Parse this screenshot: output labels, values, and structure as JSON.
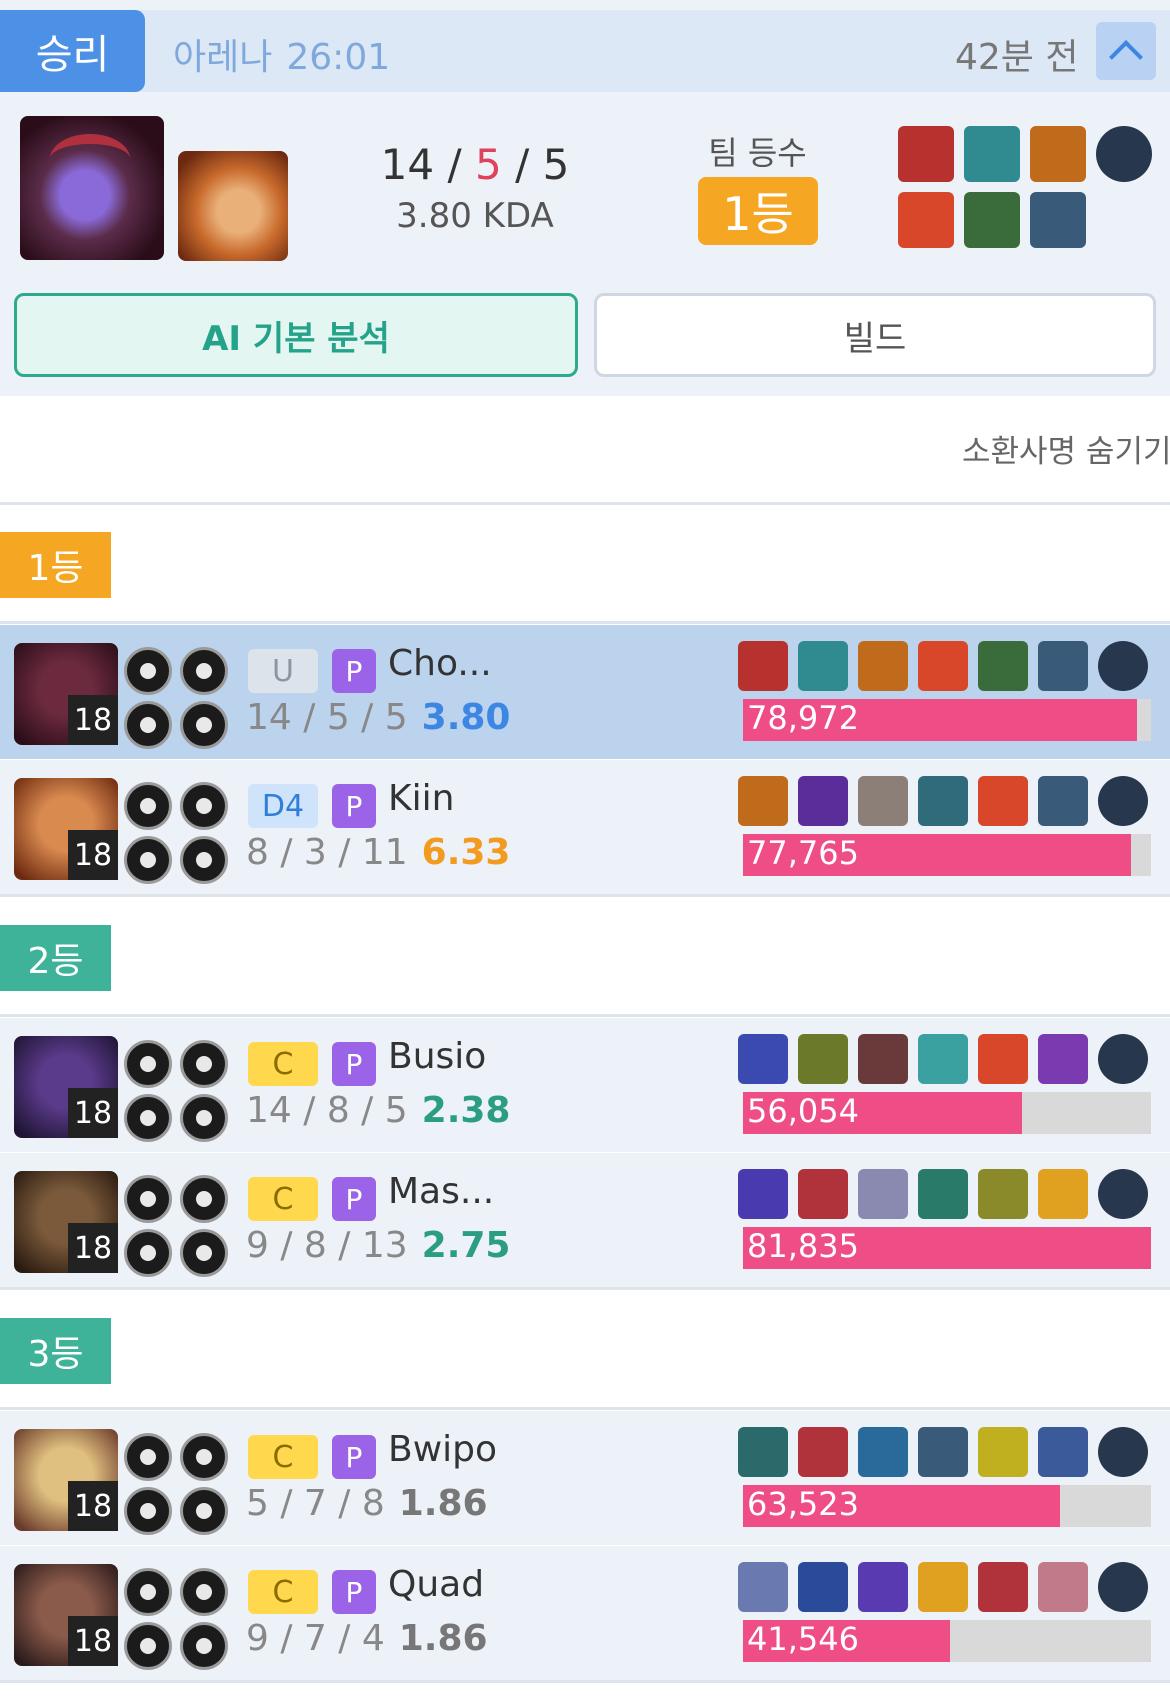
{
  "header": {
    "result": "승리",
    "mode": "아레나",
    "duration": "26:01",
    "time_ago": "42분 전"
  },
  "summary": {
    "kills": "14",
    "deaths": "5",
    "assists": "5",
    "kda_ratio": "3.80 KDA",
    "team_rank_label": "팀 등수",
    "team_rank": "1등"
  },
  "tabs": {
    "ai": "AI 기본 분석",
    "build": "빌드"
  },
  "hide_names_label": "소환사명 숨기기",
  "colors": {
    "win_blue": "#4c91e6",
    "rank_orange": "#f5a623",
    "rank_teal": "#3fb39a",
    "damage_pink": "#ee4d86",
    "ratio_blue": "#3d86e4",
    "ratio_orange": "#f29b20",
    "ratio_teal": "#2a9d82",
    "ratio_gray": "#777777"
  },
  "groups": [
    {
      "label": "1등",
      "color": "#f5a623",
      "players": [
        {
          "name": "Cho...",
          "tier": "U",
          "tier_bg": "#dde3ea",
          "tier_color": "#8c96a3",
          "badge": "P",
          "level": "18",
          "kills": "14",
          "deaths": "5",
          "assists": "5",
          "ratio": "3.80",
          "ratio_color": "#3d86e4",
          "damage": "78,972",
          "damage_fraction": 0.965,
          "me": true,
          "portrait": [
            "#6b2a3e",
            "#2a0d18"
          ],
          "items": [
            "#b7322f",
            "#2f8b8f",
            "#c06a1b",
            "#d9472b",
            "#3a6b3a",
            "#3a5a7a",
            "#26374e"
          ]
        },
        {
          "name": "Kiin",
          "tier": "D4",
          "tier_bg": "#cfe3fb",
          "tier_color": "#2f7fd8",
          "badge": "P",
          "level": "18",
          "kills": "8",
          "deaths": "3",
          "assists": "11",
          "ratio": "6.33",
          "ratio_color": "#f29b20",
          "damage": "77,765",
          "damage_fraction": 0.95,
          "me": false,
          "portrait": [
            "#d98a4f",
            "#6d2a10"
          ],
          "items": [
            "#c06a1b",
            "#5a2d9a",
            "#8b7f78",
            "#2f6b7a",
            "#d9472b",
            "#3a5a7a",
            "#26374e"
          ]
        }
      ]
    },
    {
      "label": "2등",
      "color": "#3fb39a",
      "players": [
        {
          "name": "Busio",
          "tier": "C",
          "tier_bg": "#ffd84d",
          "tier_color": "#8a6d00",
          "badge": "P",
          "level": "18",
          "kills": "14",
          "deaths": "8",
          "assists": "5",
          "ratio": "2.38",
          "ratio_color": "#2a9d82",
          "damage": "56,054",
          "damage_fraction": 0.685,
          "me": false,
          "portrait": [
            "#5a3a8a",
            "#1e1432"
          ],
          "items": [
            "#3a4ab0",
            "#6b7a2a",
            "#6a3a3a",
            "#3aa0a0",
            "#d9472b",
            "#7a3ab0",
            "#26374e"
          ]
        },
        {
          "name": "Mas...",
          "tier": "C",
          "tier_bg": "#ffd84d",
          "tier_color": "#8a6d00",
          "badge": "P",
          "level": "18",
          "kills": "9",
          "deaths": "8",
          "assists": "13",
          "ratio": "2.75",
          "ratio_color": "#2a9d82",
          "damage": "81,835",
          "damage_fraction": 1.0,
          "me": false,
          "portrait": [
            "#7a5a3a",
            "#2a1a10"
          ],
          "items": [
            "#4a3ab0",
            "#b0323a",
            "#8a8ab0",
            "#2a7a6a",
            "#8a8a2a",
            "#e0a020",
            "#26374e"
          ]
        }
      ]
    },
    {
      "label": "3등",
      "color": "#3fb39a",
      "players": [
        {
          "name": "Bwipo",
          "tier": "C",
          "tier_bg": "#ffd84d",
          "tier_color": "#8a6d00",
          "badge": "P",
          "level": "18",
          "kills": "5",
          "deaths": "7",
          "assists": "8",
          "ratio": "1.86",
          "ratio_color": "#777777",
          "damage": "63,523",
          "damage_fraction": 0.776,
          "me": false,
          "portrait": [
            "#e0c080",
            "#6a3a2a"
          ],
          "items": [
            "#2a6a6a",
            "#b0323a",
            "#2a6a9a",
            "#3a5a7a",
            "#c0b020",
            "#3a5a9a",
            "#26374e"
          ]
        },
        {
          "name": "Quad",
          "tier": "C",
          "tier_bg": "#ffd84d",
          "tier_color": "#8a6d00",
          "badge": "P",
          "level": "18",
          "kills": "9",
          "deaths": "7",
          "assists": "4",
          "ratio": "1.86",
          "ratio_color": "#777777",
          "damage": "41,546",
          "damage_fraction": 0.508,
          "me": false,
          "portrait": [
            "#8a5a4a",
            "#2a1a1a"
          ],
          "items": [
            "#6a7ab0",
            "#2a4a9a",
            "#5a3ab0",
            "#e0a020",
            "#b0323a",
            "#c07a8a",
            "#26374e"
          ]
        }
      ]
    }
  ]
}
